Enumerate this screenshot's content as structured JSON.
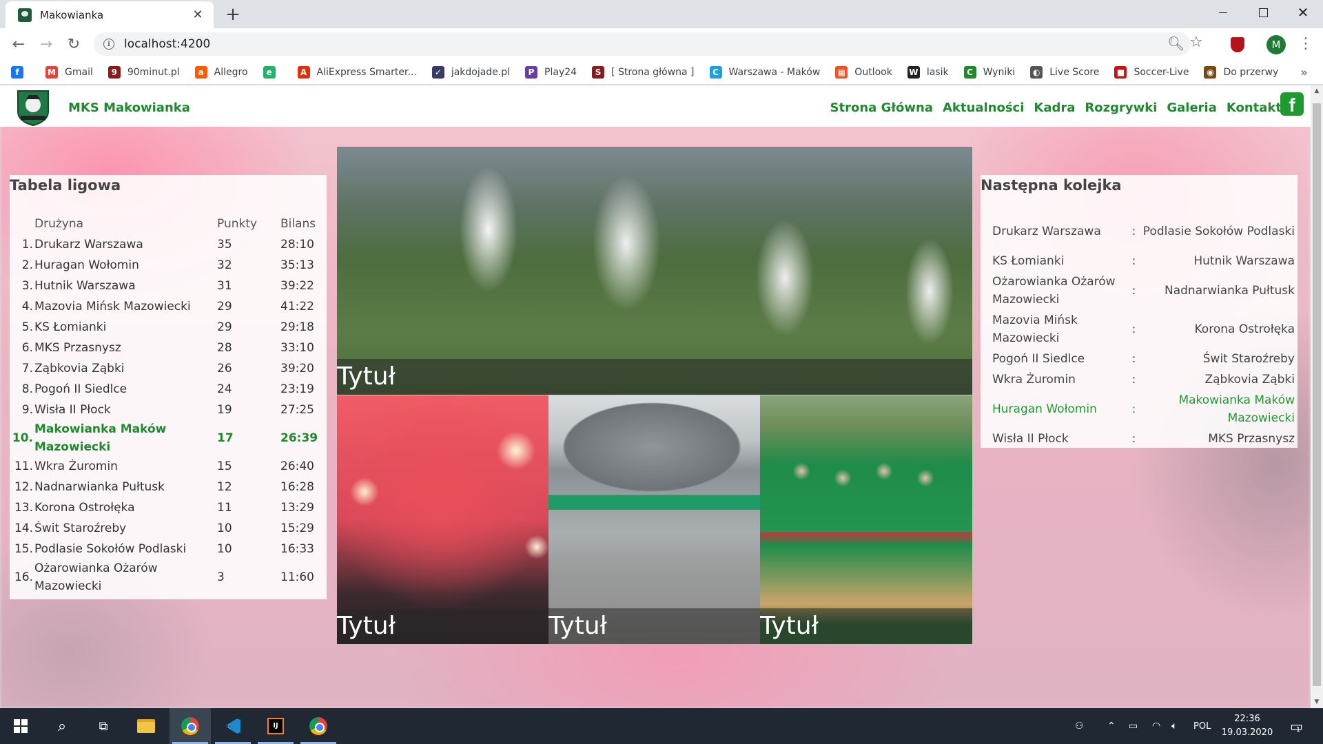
{
  "browser": {
    "tab_title": "Makowianka",
    "url": "localhost:4200",
    "profile_initial": "M",
    "bookmarks": [
      {
        "label": "",
        "icon": "facebook-icon",
        "color": "#1877f2",
        "glyph": "f"
      },
      {
        "label": "Gmail",
        "icon": "gmail-icon",
        "color": "#ea4335",
        "glyph": "M"
      },
      {
        "label": "90minut.pl",
        "icon": "90minut-icon",
        "color": "#8b1a1a",
        "glyph": "9"
      },
      {
        "label": "Allegro",
        "icon": "allegro-icon",
        "color": "#ff5a00",
        "glyph": "a"
      },
      {
        "label": "",
        "icon": "leaf-icon",
        "color": "#1fb36b",
        "glyph": "e"
      },
      {
        "label": "AliExpress Smarter...",
        "icon": "aliexpress-icon",
        "color": "#e62e04",
        "glyph": "A"
      },
      {
        "label": "jakdojade.pl",
        "icon": "jakdojade-icon",
        "color": "#3a3a6a",
        "glyph": "✓"
      },
      {
        "label": "Play24",
        "icon": "play24-icon",
        "color": "#6b3fa0",
        "glyph": "P"
      },
      {
        "label": "[ Strona główna ]",
        "icon": "strona-icon",
        "color": "#8b1a1a",
        "glyph": "S"
      },
      {
        "label": "Warszawa - Maków",
        "icon": "warszawa-icon",
        "color": "#1ea0e0",
        "glyph": "C"
      },
      {
        "label": "Outlook",
        "icon": "outlook-icon",
        "color": "#f25022",
        "glyph": "▦"
      },
      {
        "label": "lasik",
        "icon": "wikipedia-icon",
        "color": "#222222",
        "glyph": "W"
      },
      {
        "label": "Wyniki",
        "icon": "wyniki-icon",
        "color": "#1e8a2c",
        "glyph": "C"
      },
      {
        "label": "Live Score",
        "icon": "livescore-icon",
        "color": "#555555",
        "glyph": "◐"
      },
      {
        "label": "Soccer-Live",
        "icon": "soccerlive-icon",
        "color": "#d01010",
        "glyph": "■"
      },
      {
        "label": "Do przerwy",
        "icon": "doprzerwy-icon",
        "color": "#7a4a10",
        "glyph": "◉"
      }
    ]
  },
  "site": {
    "brand": "MKS Makowianka",
    "nav": [
      "Strona Główna",
      "Aktualności",
      "Kadra",
      "Rozgrywki",
      "Galeria",
      "Kontakt"
    ],
    "accent": "#1e8a2c"
  },
  "league": {
    "title": "Tabela ligowa",
    "headers": {
      "team": "Drużyna",
      "points": "Punkty",
      "balance": "Bilans"
    },
    "rows": [
      {
        "pos": "1.",
        "team": "Drukarz Warszawa",
        "points": "35",
        "balance": "28:10"
      },
      {
        "pos": "2.",
        "team": "Huragan Wołomin",
        "points": "32",
        "balance": "35:13"
      },
      {
        "pos": "3.",
        "team": "Hutnik Warszawa",
        "points": "31",
        "balance": "39:22"
      },
      {
        "pos": "4.",
        "team": "Mazovia Mińsk Mazowiecki",
        "points": "29",
        "balance": "41:22"
      },
      {
        "pos": "5.",
        "team": "KS Łomianki",
        "points": "29",
        "balance": "29:18"
      },
      {
        "pos": "6.",
        "team": "MKS Przasnysz",
        "points": "28",
        "balance": "33:10"
      },
      {
        "pos": "7.",
        "team": "Ząbkovia Ząbki",
        "points": "26",
        "balance": "39:20"
      },
      {
        "pos": "8.",
        "team": "Pogoń II Siedlce",
        "points": "24",
        "balance": "23:19"
      },
      {
        "pos": "9.",
        "team": "Wisła II Płock",
        "points": "19",
        "balance": "27:25"
      },
      {
        "pos": "10.",
        "team": "Makowianka Maków Mazowiecki",
        "points": "17",
        "balance": "26:39",
        "highlight": true
      },
      {
        "pos": "11.",
        "team": "Wkra Żuromin",
        "points": "15",
        "balance": "26:40"
      },
      {
        "pos": "12.",
        "team": "Nadnarwianka Pułtusk",
        "points": "12",
        "balance": "16:28"
      },
      {
        "pos": "13.",
        "team": "Korona Ostrołęka",
        "points": "11",
        "balance": "13:29"
      },
      {
        "pos": "14.",
        "team": "Świt Staroźreby",
        "points": "10",
        "balance": "15:29"
      },
      {
        "pos": "15.",
        "team": "Podlasie Sokołów Podlaski",
        "points": "10",
        "balance": "16:33"
      },
      {
        "pos": "16.",
        "team": "Ożarowianka Ożarów Mazowiecki",
        "points": "3",
        "balance": "11:60"
      }
    ]
  },
  "gallery": {
    "captions": [
      "Tytuł",
      "Tytuł",
      "Tytuł",
      "Tytuł"
    ]
  },
  "next_round": {
    "title": "Następna kolejka",
    "separator": ":",
    "matches": [
      {
        "home": "Drukarz Warszawa",
        "away": "Podlasie Sokołów Podlaski"
      },
      {
        "home": "KS Łomianki",
        "away": "Hutnik Warszawa"
      },
      {
        "home": "Ożarowianka Ożarów Mazowiecki",
        "away": "Nadnarwianka Pułtusk"
      },
      {
        "home": "Mazovia Mińsk Mazowiecki",
        "away": "Korona Ostrołęka"
      },
      {
        "home": "Pogoń II Siedlce",
        "away": "Świt Staroźreby"
      },
      {
        "home": "Wkra Żuromin",
        "away": "Ząbkovia Ząbki"
      },
      {
        "home": "Huragan Wołomin",
        "away": "Makowianka Maków Mazowiecki",
        "highlight": true
      },
      {
        "home": "Wisła II Płock",
        "away": "MKS Przasnysz"
      }
    ]
  },
  "taskbar": {
    "language": "POL",
    "time": "22:36",
    "date": "19.03.2020",
    "notifications": "1"
  }
}
